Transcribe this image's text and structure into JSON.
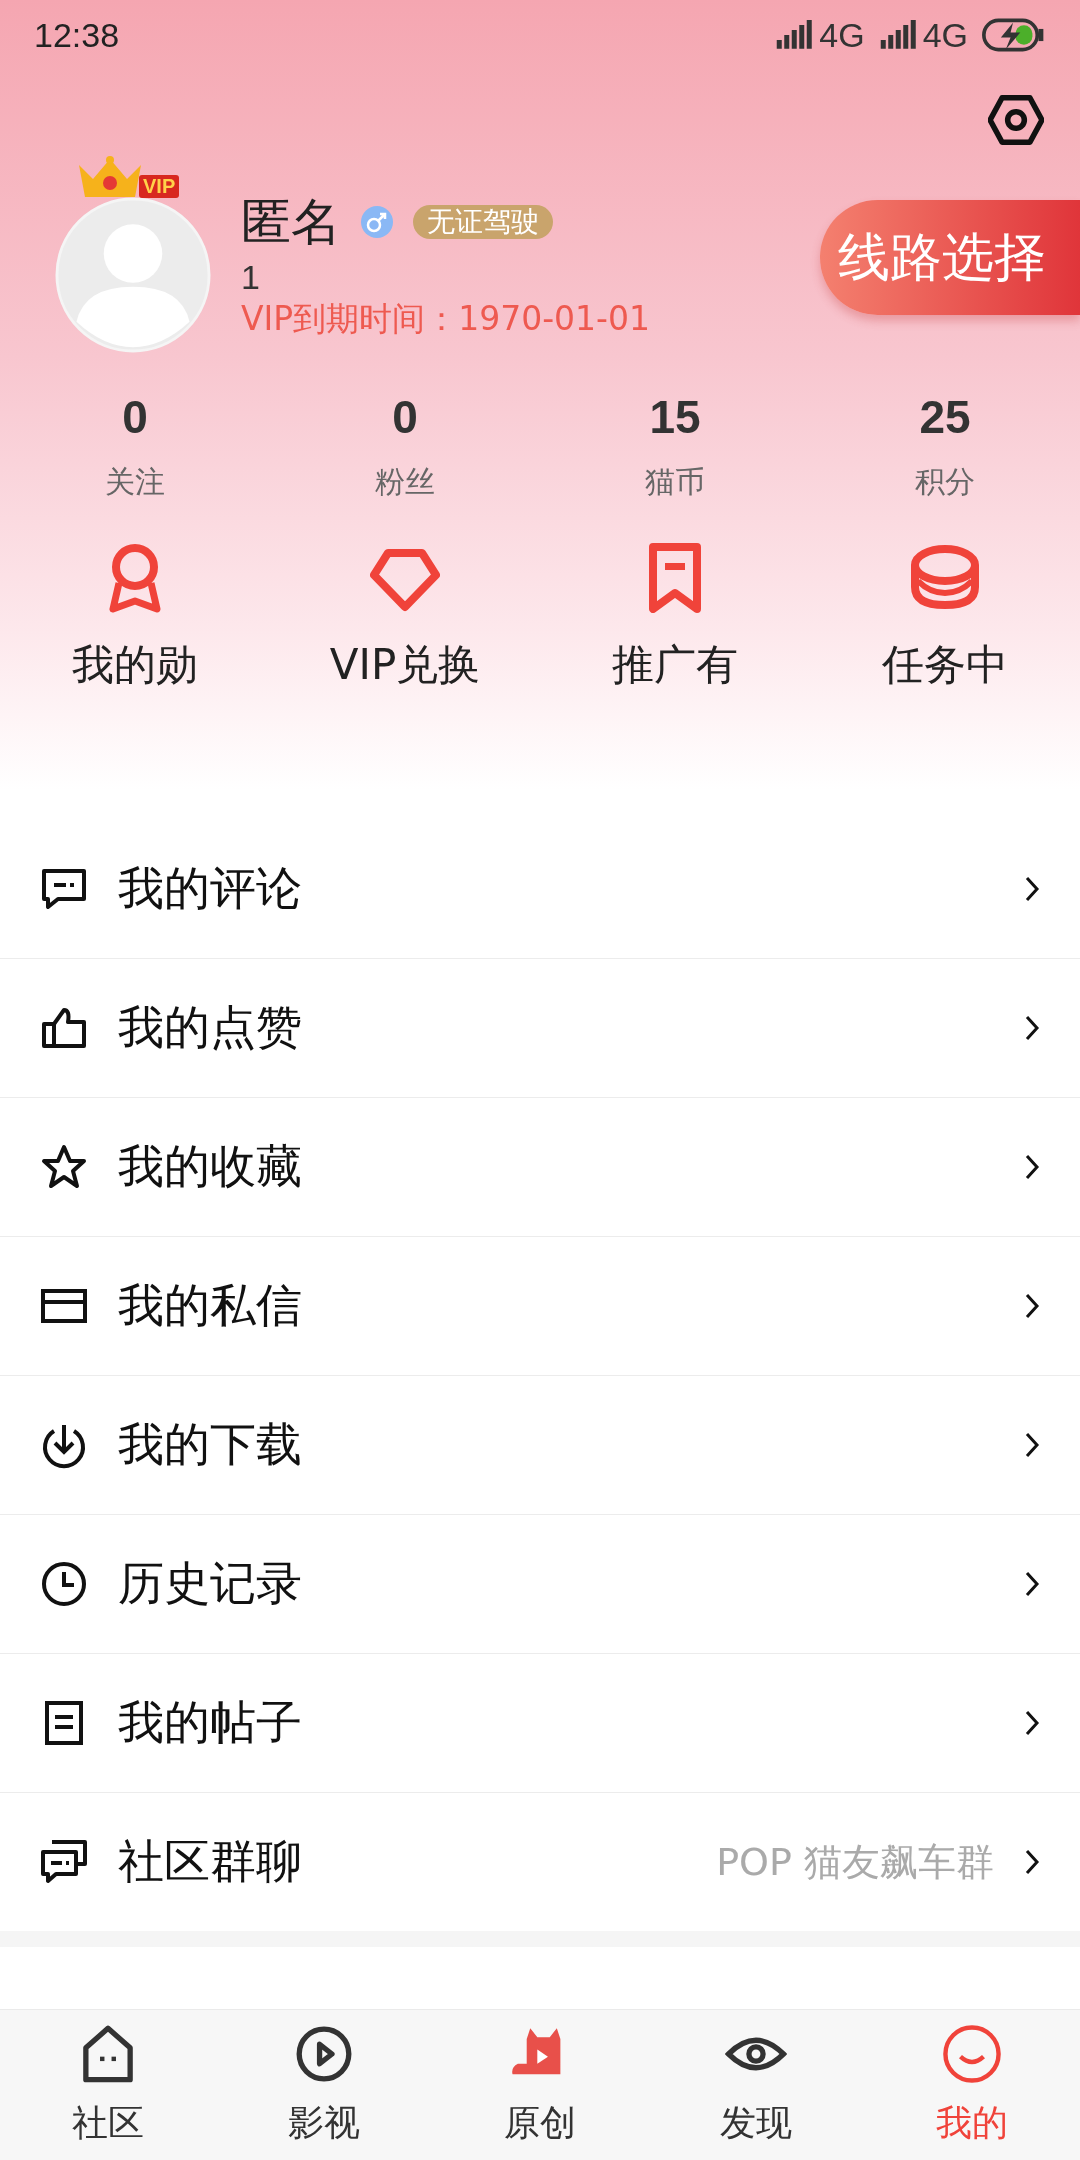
{
  "status_bar": {
    "time": "12:38",
    "networks": [
      "4G",
      "4G"
    ]
  },
  "profile": {
    "vip_badge": "VIP",
    "name": "匿名",
    "badge": "无证驾驶",
    "user_id": "1",
    "vip_expiry": "VIP到期时间：1970-01-01"
  },
  "route_button": "线路选择",
  "stats": [
    {
      "value": "0",
      "label": "关注"
    },
    {
      "value": "0",
      "label": "粉丝"
    },
    {
      "value": "15",
      "label": "猫币"
    },
    {
      "value": "25",
      "label": "积分"
    }
  ],
  "features": [
    {
      "label": "我的勋"
    },
    {
      "label": "VIP兑换"
    },
    {
      "label": "推广有"
    },
    {
      "label": "任务中"
    }
  ],
  "menu": [
    {
      "label": "我的评论"
    },
    {
      "label": "我的点赞"
    },
    {
      "label": "我的收藏"
    },
    {
      "label": "我的私信"
    },
    {
      "label": "我的下载"
    },
    {
      "label": "历史记录"
    },
    {
      "label": "我的帖子"
    },
    {
      "label": "社区群聊",
      "detail": "POP 猫友飙车群"
    }
  ],
  "tabs": [
    {
      "label": "社区",
      "selected": false
    },
    {
      "label": "影视",
      "selected": false
    },
    {
      "label": "原创",
      "selected": false
    },
    {
      "label": "发现",
      "selected": false
    },
    {
      "label": "我的",
      "selected": true
    }
  ]
}
